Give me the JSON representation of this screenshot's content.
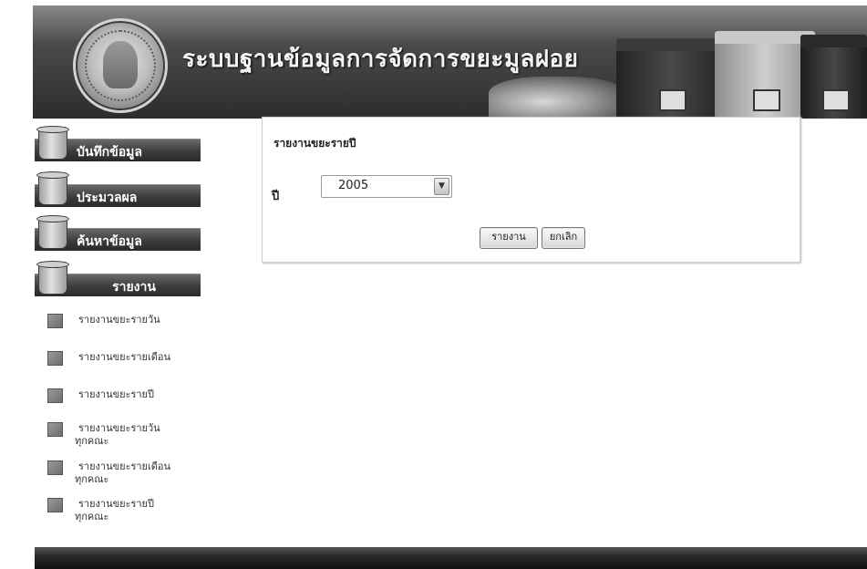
{
  "header": {
    "title": "ระบบฐานข้อมูลการจัดการขยะมูลฝอย"
  },
  "sidebar": {
    "menus": [
      {
        "label": "บันทึกข้อมูล"
      },
      {
        "label": "ประมวลผล"
      },
      {
        "label": "ค้นหาข้อมูล"
      },
      {
        "label": "รายงาน"
      }
    ],
    "report_items": [
      {
        "label": "รายงานขยะรายวัน",
        "label2": ""
      },
      {
        "label": "รายงานขยะรายเดือน",
        "label2": ""
      },
      {
        "label": "รายงานขยะรายปี",
        "label2": ""
      },
      {
        "label": "รายงานขยะรายวัน",
        "label2": "ทุกคณะ"
      },
      {
        "label": "รายงานขยะรายเดือน",
        "label2": "ทุกคณะ"
      },
      {
        "label": "รายงานขยะรายปี",
        "label2": "ทุกคณะ"
      }
    ]
  },
  "report_form": {
    "title": "รายงานขยะรายปี",
    "year_label": "ปี",
    "year_value": "2005",
    "report_button": "รายงาน",
    "cancel_button": "ยกเลิก"
  },
  "icons": {
    "menu_icon": "trash-bin-icon",
    "item_icon": "report-doc-icon",
    "select_arrow": "chevron-down-icon"
  }
}
